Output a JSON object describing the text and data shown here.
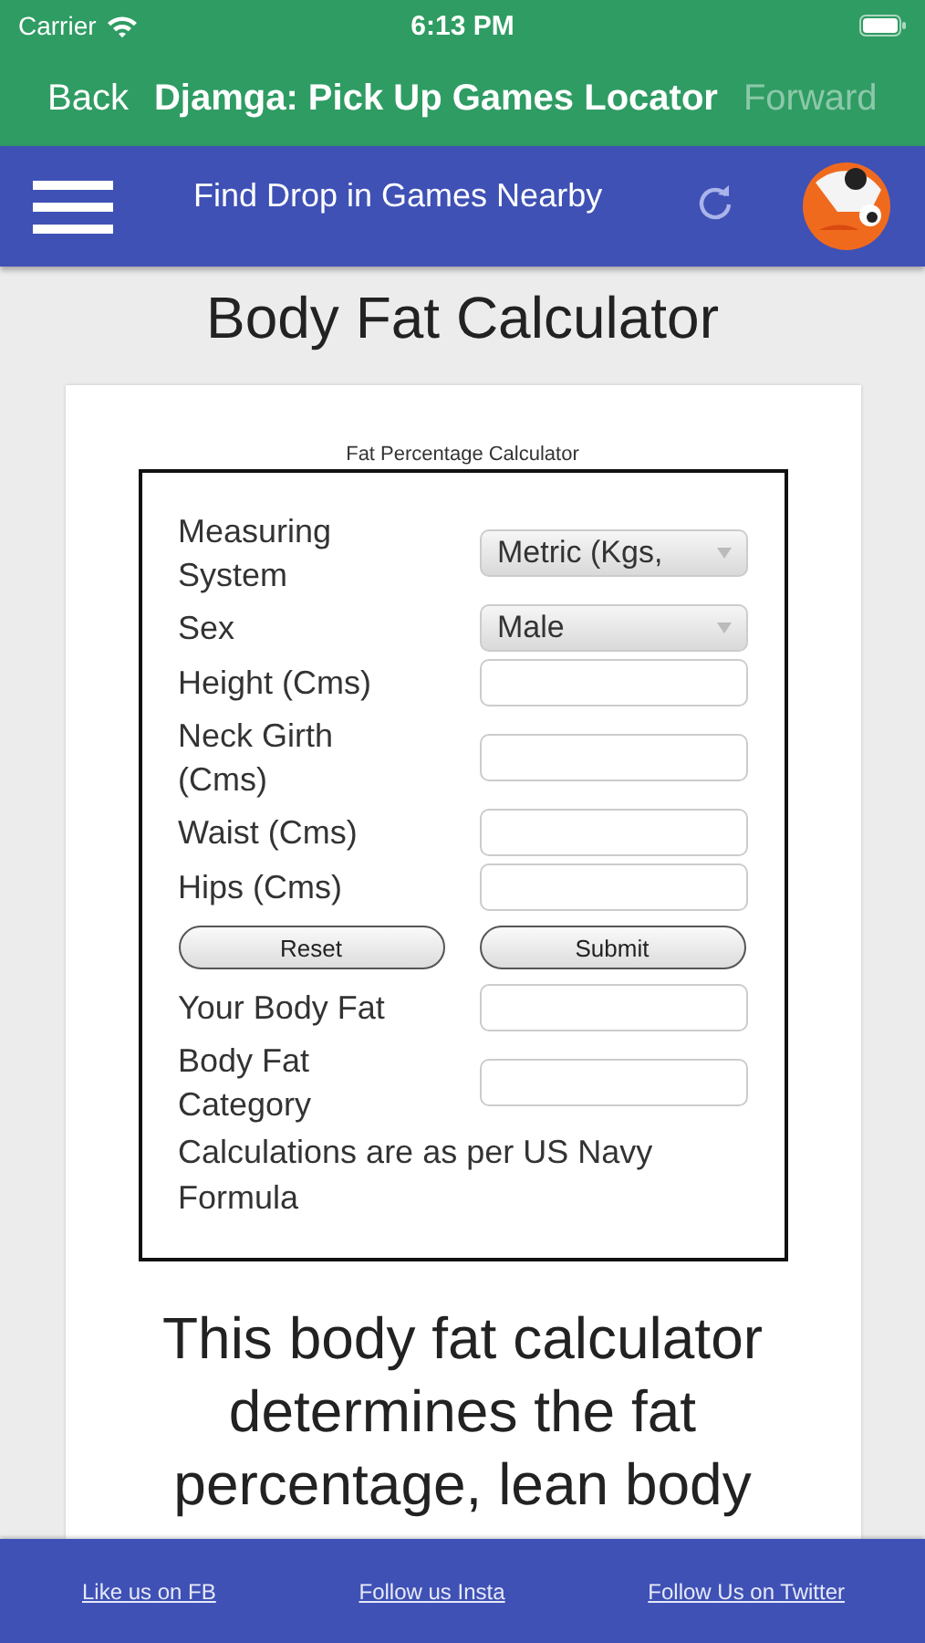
{
  "status_bar": {
    "carrier": "Carrier",
    "time": "6:13 PM"
  },
  "nav_bar": {
    "back": "Back",
    "title": "Djamga: Pick Up Games Locator",
    "forward": {
      "label": "Forward",
      "disabled": true
    }
  },
  "app_bar": {
    "title": "Find Drop in Games Nearby"
  },
  "page_title": "Body Fat Calculator",
  "calculator": {
    "caption": "Fat Percentage Calculator",
    "fields": [
      {
        "kind": "select",
        "label": "Measuring System",
        "value": "Metric (Kgs,"
      },
      {
        "kind": "select",
        "label": "Sex",
        "value": "Male"
      },
      {
        "kind": "input",
        "label": "Height (Cms)"
      },
      {
        "kind": "input",
        "label": "Neck Girth (Cms)"
      },
      {
        "kind": "input",
        "label": "Waist (Cms)"
      },
      {
        "kind": "input",
        "label": "Hips (Cms)"
      },
      {
        "kind": "buttons",
        "buttons": [
          "Reset",
          "Submit"
        ]
      },
      {
        "kind": "input",
        "label": "Your Body Fat"
      },
      {
        "kind": "input",
        "label": "Body Fat Category"
      },
      {
        "kind": "note",
        "text": "Calculations are as per US Navy Formula"
      }
    ]
  },
  "description": "This body fat calculator determines the fat percentage, lean body",
  "footer": {
    "links": [
      "Like us on FB",
      "Follow us Insta",
      "Follow Us on Twitter"
    ]
  }
}
